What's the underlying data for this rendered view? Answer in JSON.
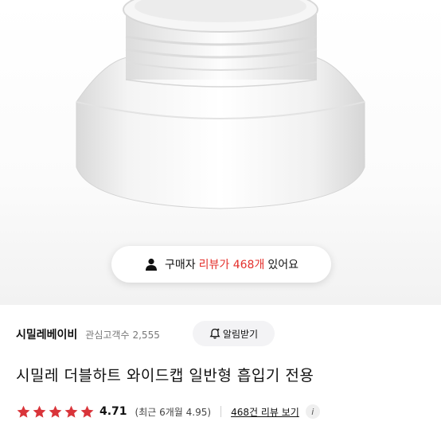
{
  "review_banner": {
    "prefix": "구매자",
    "highlight": "리뷰가 468개",
    "suffix": "있어요"
  },
  "brand": {
    "name": "시밀레베이비",
    "interest_label": "관심고객수",
    "interest_count": "2,555"
  },
  "alarm_button": {
    "label": "알림받기"
  },
  "product": {
    "title": "시밀레 더블하트 와이드캡 일반형 흡입기 전용"
  },
  "rating": {
    "value": 4.71,
    "score": "4.71",
    "stars_filled": 5,
    "recent": "(최근 6개월 4.95)",
    "review_link": "468건 리뷰 보기",
    "star_color": "#d9343a"
  },
  "colors": {
    "accent": "#e4302c"
  },
  "icons": [
    "person-icon",
    "bell-icon",
    "star-icon",
    "info-icon"
  ]
}
